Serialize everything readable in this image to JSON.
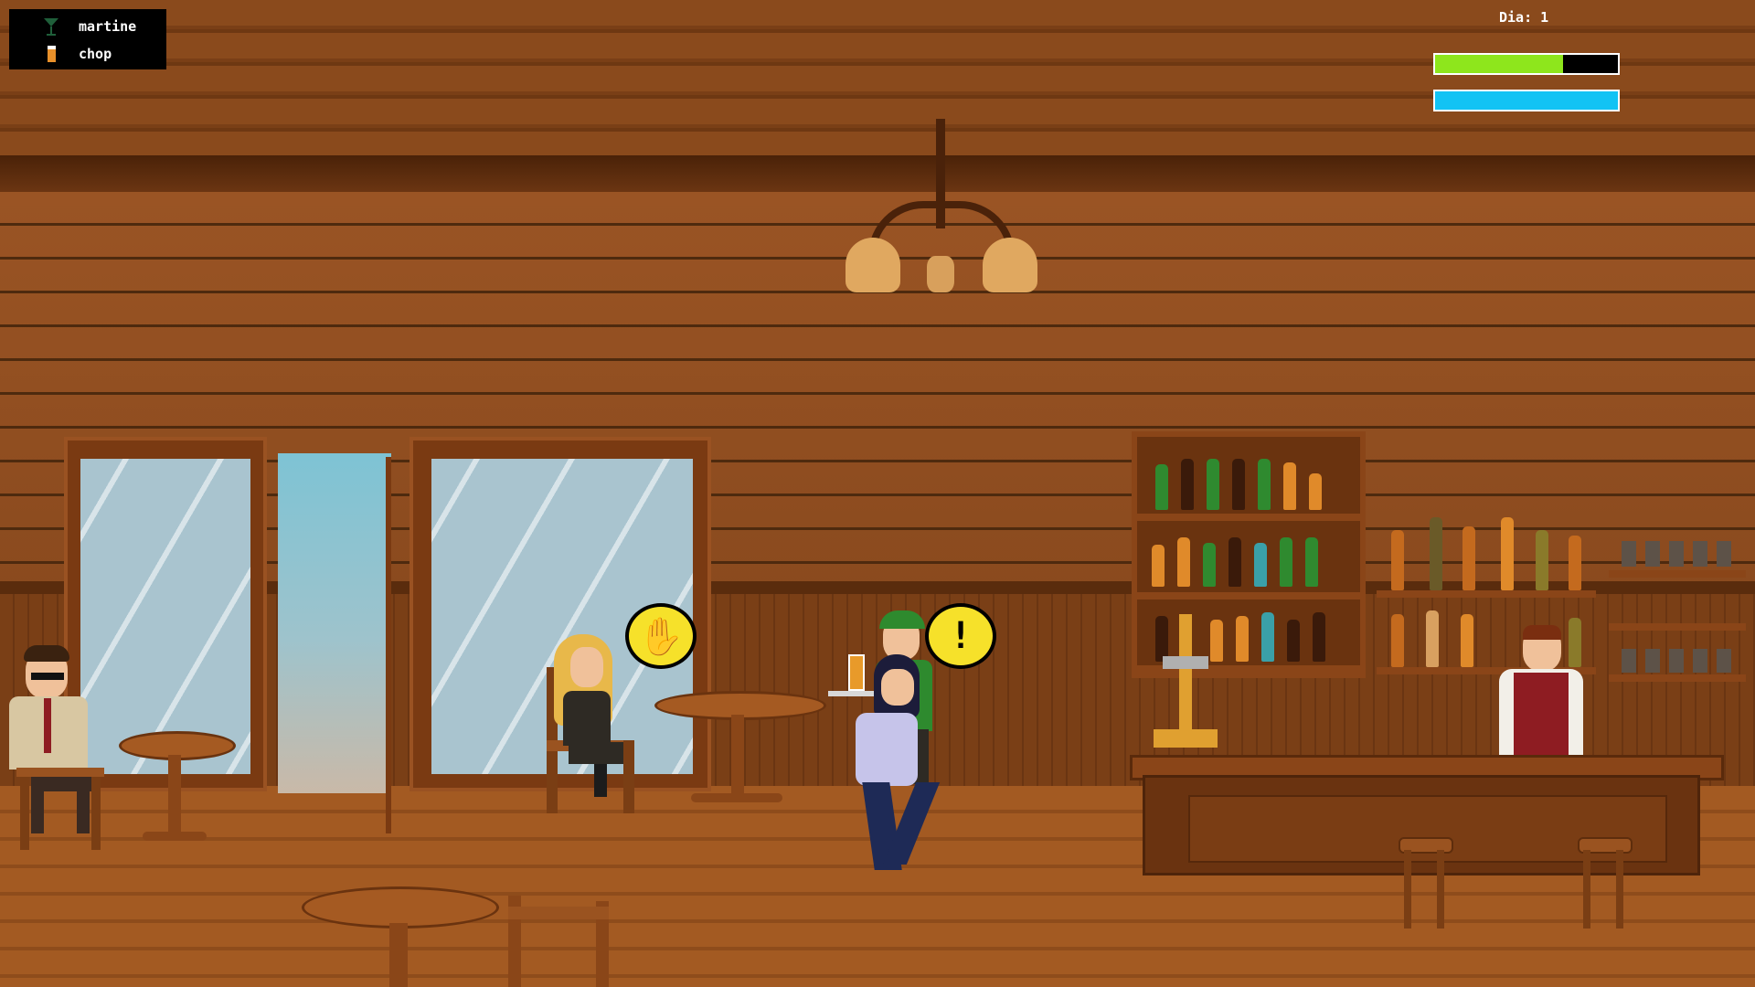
{
  "orders": [
    {
      "label": "martine",
      "icon": "martini-glass-icon"
    },
    {
      "label": "chop",
      "icon": "beer-mug-icon"
    }
  ],
  "hud": {
    "day_label": "Dia: 1",
    "bars": [
      {
        "name": "patience-bar",
        "fill": 0.7,
        "color": "#8ee61c"
      },
      {
        "name": "energy-bar",
        "fill": 1.0,
        "color": "#12c3f4"
      }
    ]
  },
  "bubbles": {
    "customer_blonde": "hand-raise-icon",
    "customer_cap": "exclamation-icon",
    "exclamation_glyph": "!"
  },
  "colors": {
    "bubble": "#f6e12a",
    "wall": "#9a5424",
    "floor": "#a35a22"
  }
}
